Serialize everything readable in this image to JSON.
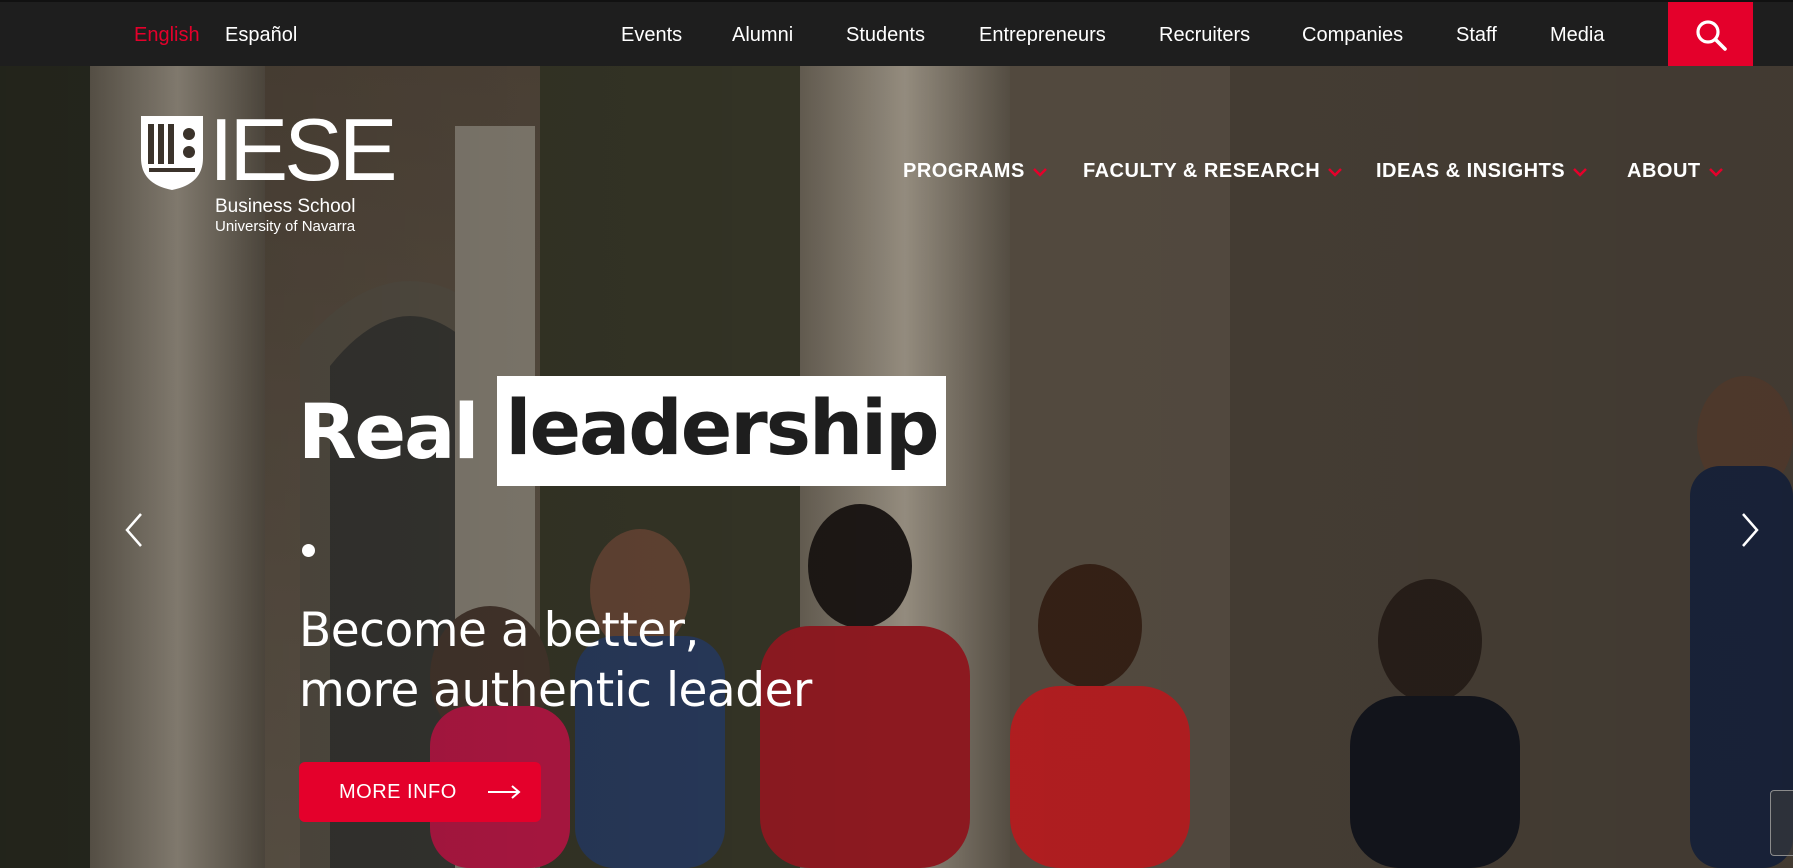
{
  "topbar": {
    "languages": [
      {
        "label": "English",
        "active": true
      },
      {
        "label": "Español",
        "active": false
      }
    ],
    "links": [
      "Events",
      "Alumni",
      "Students",
      "Entrepreneurs",
      "Recruiters",
      "Companies",
      "Staff",
      "Media"
    ],
    "search_icon": "search-icon"
  },
  "logo": {
    "wordmark": "IESE",
    "line1": "Business School",
    "line2": "University of Navarra"
  },
  "mainnav": {
    "items": [
      {
        "label": "PROGRAMS",
        "icon": "chevron-down-icon"
      },
      {
        "label": "FACULTY & RESEARCH",
        "icon": "chevron-down-icon"
      },
      {
        "label": "IDEAS & INSIGHTS",
        "icon": "chevron-down-icon"
      },
      {
        "label": "ABOUT",
        "icon": "chevron-down-icon"
      }
    ]
  },
  "hero": {
    "headline_plain": "Real",
    "headline_highlight": "leadership",
    "subtitle_line1": "Become a better,",
    "subtitle_line2": "more authentic leader",
    "cta_label": "MORE INFO",
    "prev_icon": "chevron-left-icon",
    "next_icon": "chevron-right-icon"
  },
  "colors": {
    "accent": "#e4002b",
    "topbar_bg": "#1e1e1e",
    "text_light": "#ffffff",
    "text_dark": "#1e1e1e"
  }
}
